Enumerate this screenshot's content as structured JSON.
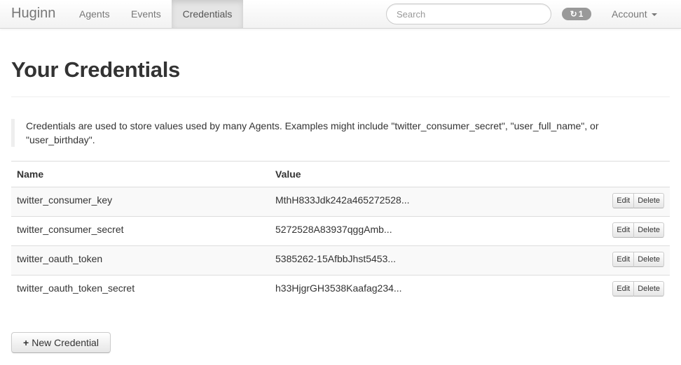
{
  "navbar": {
    "brand": "Huginn",
    "links": [
      "Agents",
      "Events",
      "Credentials"
    ],
    "search_placeholder": "Search",
    "jobs_count": "1",
    "account_label": "Account"
  },
  "page": {
    "title": "Your Credentials",
    "note": "Credentials are used to store values used by many Agents. Examples might include \"twitter_consumer_secret\", \"user_full_name\", or \"user_birthday\"."
  },
  "table": {
    "columns": [
      "Name",
      "Value"
    ],
    "rows": [
      {
        "name": "twitter_consumer_key",
        "value": "MthH833Jdk242a465272528..."
      },
      {
        "name": "twitter_consumer_secret",
        "value": "5272528A83937qggAmb..."
      },
      {
        "name": "twitter_oauth_token",
        "value": "5385262-15AfbbJhst5453..."
      },
      {
        "name": "twitter_oauth_token_secret",
        "value": "h33HjgrGH3538Kaafag234..."
      }
    ],
    "edit_label": "Edit",
    "delete_label": "Delete"
  },
  "new_button_label": "New Credential",
  "icons": {
    "sync": "sync-icon",
    "plus": "plus-icon",
    "caret": "caret-down-icon"
  }
}
